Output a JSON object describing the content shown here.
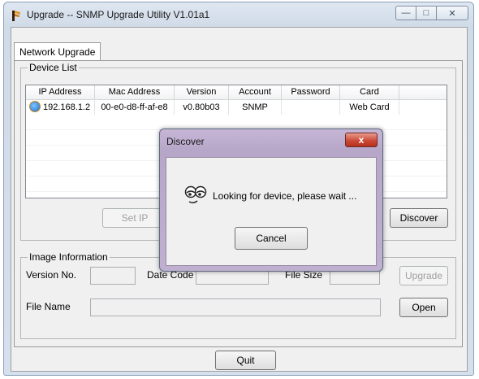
{
  "window": {
    "title": "Upgrade -- SNMP Upgrade Utility V1.01a1",
    "controls": {
      "minimize": "—",
      "maximize": "□",
      "close": "✕"
    }
  },
  "tab": {
    "label": "Network Upgrade"
  },
  "device_list": {
    "label": "Device List",
    "columns": [
      "IP Address",
      "Mac Address",
      "Version",
      "Account",
      "Password",
      "Card"
    ],
    "rows": [
      [
        "192.168.1.2",
        "00-e0-d8-ff-af-e8",
        "v0.80b03",
        "SNMP",
        "",
        "Web Card"
      ]
    ],
    "buttons": {
      "set_ip": "Set IP",
      "discover": "Discover"
    }
  },
  "image_info": {
    "label": "Image Information",
    "version_no": "Version No.",
    "date_code": "Date Code",
    "file_size": "File Size",
    "file_name": "File Name",
    "buttons": {
      "upgrade": "Upgrade",
      "open": "Open"
    }
  },
  "quit_label": "Quit",
  "dialog": {
    "title": "Discover",
    "close": "x",
    "message": "Looking for device, please wait ...",
    "cancel": "Cancel"
  }
}
